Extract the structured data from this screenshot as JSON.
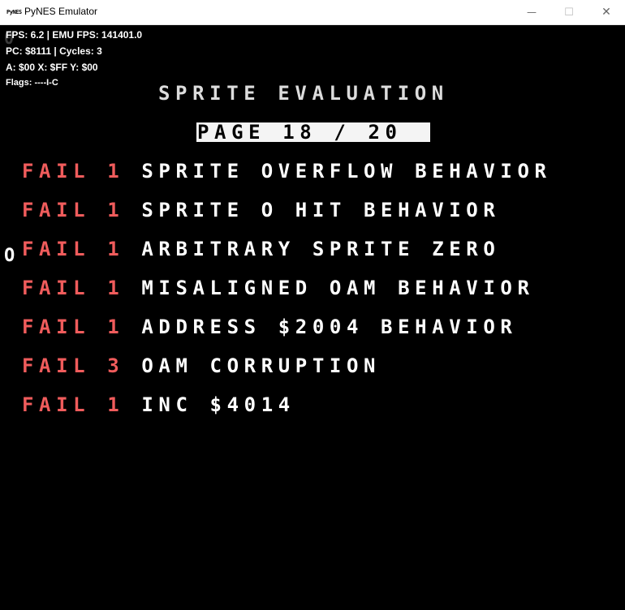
{
  "window": {
    "title": "PyNES Emulator",
    "icon_text": "PyNES",
    "controls": {
      "minimize": "—",
      "maximize": "☐",
      "close": "✕"
    }
  },
  "hud": {
    "fps": "FPS: 6.2 | EMU FPS: 141401.0",
    "pc": "PC: $8111 | Cycles: 3",
    "regs": "A: $00 X: $FF Y: $00",
    "flags": "Flags: ----I-C"
  },
  "screen": {
    "heading": "SPRITE EVALUATION",
    "page_label": "PAGE 18 / 20",
    "cursor": "O",
    "ghost": "0",
    "results": [
      {
        "status": "FAIL 1",
        "test": "SPRITE OVERFLOW BEHAVIOR"
      },
      {
        "status": "FAIL 1",
        "test": "SPRITE O HIT BEHAVIOR"
      },
      {
        "status": "FAIL 1",
        "test": "ARBITRARY SPRITE ZERO"
      },
      {
        "status": "FAIL 1",
        "test": "MISALIGNED OAM BEHAVIOR"
      },
      {
        "status": "FAIL 1",
        "test": "ADDRESS $2004 BEHAVIOR"
      },
      {
        "status": "FAIL 3",
        "test": "OAM CORRUPTION"
      },
      {
        "status": "FAIL 1",
        "test": "INC $4014"
      }
    ]
  },
  "colors": {
    "fail": "#f05c5c",
    "text": "#ffffff",
    "background": "#000000"
  }
}
